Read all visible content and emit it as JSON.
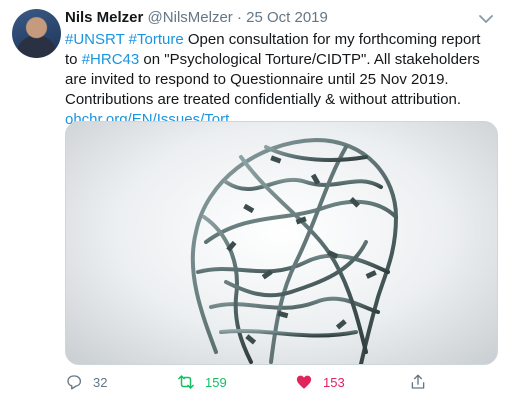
{
  "author": {
    "name": "Nils Melzer",
    "handle": "@NilsMelzer",
    "separator": "·",
    "date": "25 Oct 2019"
  },
  "tweet": {
    "hashtag_1": "#UNSRT",
    "hashtag_2": "#Torture",
    "text_1": " Open consultation for my forthcoming report to ",
    "hashtag_3": "#HRC43",
    "text_2": " on \"Psychological Torture/CIDTP\". All stakeholders are invited to respond to Questionnaire until 25 Nov 2019. Contributions are treated confidentially & without attribution.",
    "link": "ohchr.org/EN/Issues/Tort.."
  },
  "media": {
    "icon": "barbed-wire-head-image"
  },
  "actions": {
    "reply_count": "32",
    "retweet_count": "159",
    "like_count": "153"
  },
  "colors": {
    "link": "#1b95e0",
    "retweet": "#17bf63",
    "like": "#e0245e",
    "muted": "#657786"
  }
}
